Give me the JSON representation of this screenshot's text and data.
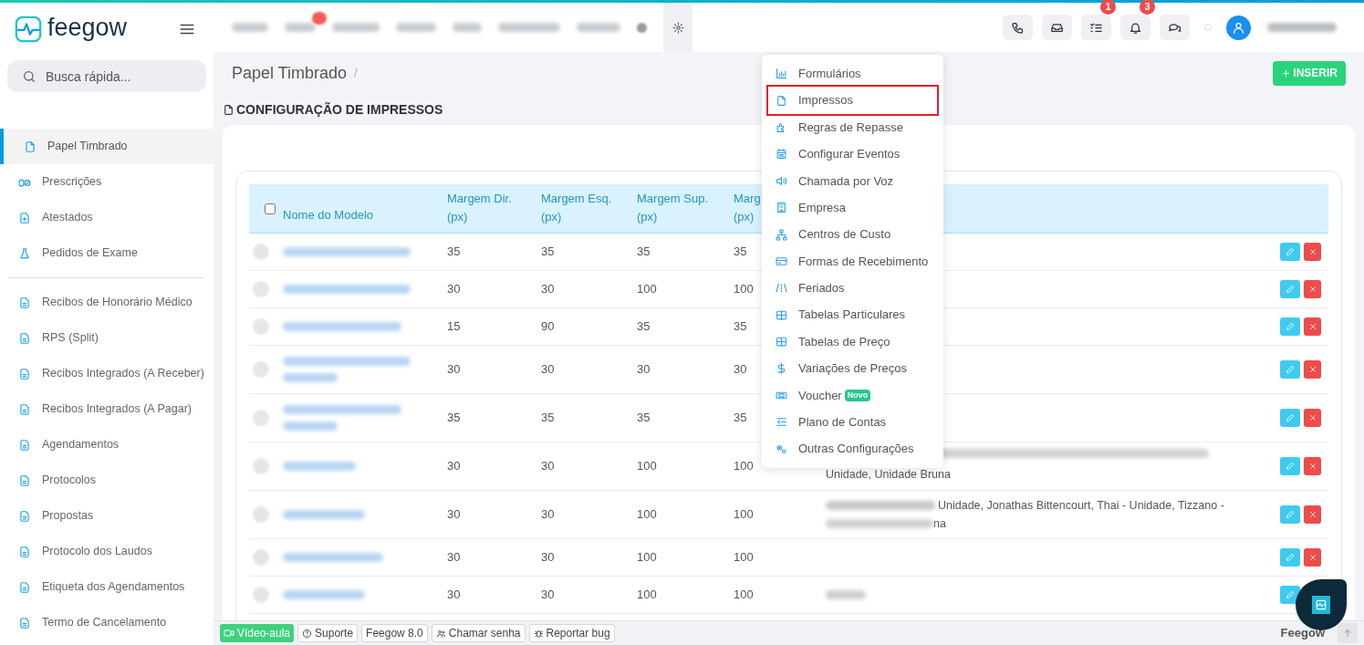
{
  "brand": {
    "name": "feegow"
  },
  "search": {
    "placeholder": "Busca rápida..."
  },
  "sidebar": {
    "groups": [
      [
        {
          "label": "Papel Timbrado",
          "selected": true
        },
        {
          "label": "Prescrições",
          "selected": false
        },
        {
          "label": "Atestados",
          "selected": false
        },
        {
          "label": "Pedidos de Exame",
          "selected": false
        }
      ],
      [
        {
          "label": "Recibos de Honorário Médico",
          "selected": false
        },
        {
          "label": "RPS (Split)",
          "selected": false
        },
        {
          "label": "Recibos Integrados (A Receber)",
          "selected": false
        },
        {
          "label": "Recibos Integrados (A Pagar)",
          "selected": false
        },
        {
          "label": "Agendamentos",
          "selected": false
        },
        {
          "label": "Protocolos",
          "selected": false
        },
        {
          "label": "Propostas",
          "selected": false
        },
        {
          "label": "Protocolo dos Laudos",
          "selected": false
        },
        {
          "label": "Etiqueta dos Agendamentos",
          "selected": false
        },
        {
          "label": "Termo de Cancelamento",
          "selected": false
        }
      ]
    ]
  },
  "toolbar": {
    "badges": [
      {
        "count": "1"
      },
      {
        "count": "3"
      }
    ]
  },
  "page": {
    "title": "Papel Timbrado",
    "separator": "/",
    "insert_button": "INSERIR",
    "section_title": "CONFIGURAÇÃO DE IMPRESSOS"
  },
  "table": {
    "select_all_checked": false,
    "columns": [
      {
        "line1": "Nome do Modelo"
      },
      {
        "line1": "Margem Dir.",
        "line2": "(px)"
      },
      {
        "line1": "Margem Esq.",
        "line2": "(px)"
      },
      {
        "line1": "Margem Sup.",
        "line2": "(px)"
      },
      {
        "line1": "Marg",
        "line2": "(px)"
      }
    ],
    "rows": [
      {
        "values": [
          "35",
          "35",
          "35",
          "35"
        ],
        "note": []
      },
      {
        "values": [
          "30",
          "30",
          "100",
          "100"
        ],
        "note": []
      },
      {
        "values": [
          "15",
          "90",
          "35",
          "35"
        ],
        "note": []
      },
      {
        "values": [
          "30",
          "30",
          "30",
          "30"
        ],
        "note": []
      },
      {
        "values": [
          "35",
          "35",
          "35",
          "35"
        ],
        "note": []
      },
      {
        "values": [
          "30",
          "30",
          "100",
          "100"
        ],
        "note": [
          "Unidade, Unidade Bruna"
        ]
      },
      {
        "values": [
          "30",
          "30",
          "100",
          "100"
        ],
        "note": [
          "Unidade, Jonathas Bittencourt, Thai - Unidade, Tizzano -",
          "na"
        ]
      },
      {
        "values": [
          "30",
          "30",
          "100",
          "100"
        ],
        "note": []
      },
      {
        "values": [
          "30",
          "30",
          "100",
          "100"
        ],
        "note": []
      }
    ]
  },
  "settings_menu": {
    "items": [
      {
        "label": "Formulários",
        "highlighted": false
      },
      {
        "label": "Impressos",
        "highlighted": true
      },
      {
        "label": "Regras de Repasse",
        "highlighted": false
      },
      {
        "label": "Configurar Eventos",
        "highlighted": false
      },
      {
        "label": "Chamada por Voz",
        "highlighted": false
      },
      {
        "label": "Empresa",
        "highlighted": false
      },
      {
        "label": "Centros de Custo",
        "highlighted": false
      },
      {
        "label": "Formas de Recebimento",
        "highlighted": false
      },
      {
        "label": "Feriados",
        "highlighted": false
      },
      {
        "label": "Tabelas Particulares",
        "highlighted": false
      },
      {
        "label": "Tabelas de Preço",
        "highlighted": false
      },
      {
        "label": "Variações de Preços",
        "highlighted": false
      },
      {
        "label": "Voucher",
        "highlighted": false,
        "badge": "Novo"
      },
      {
        "label": "Plano de Contas",
        "highlighted": false
      },
      {
        "label": "Outras Configurações",
        "highlighted": false
      }
    ]
  },
  "footer": {
    "video_button": "Vídeo-aula",
    "links": [
      "Suporte",
      "Feegow 8.0",
      "Chamar senha",
      "Reportar bug"
    ],
    "brand": "Feegow"
  }
}
